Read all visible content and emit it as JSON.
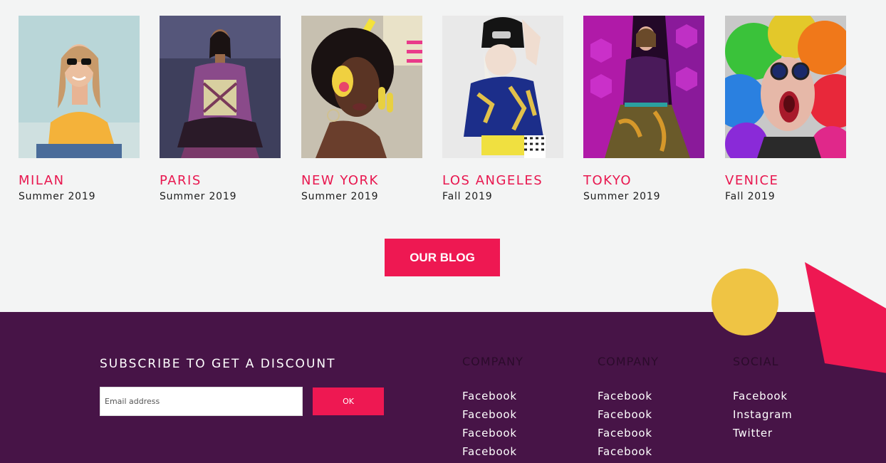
{
  "collections": [
    {
      "city": "MILAN",
      "season": "Summer 2019",
      "photo": "woman-sunglasses-yellow-shirt",
      "bg": "#b8d4d6"
    },
    {
      "city": "PARIS",
      "season": "Summer 2019",
      "photo": "model-runway-purple-top",
      "bg": "#4a4a6a"
    },
    {
      "city": "NEW YORK",
      "season": "Summer 2019",
      "photo": "woman-afro-yellow-paint",
      "bg": "#c9c4b8"
    },
    {
      "city": "LOS ANGELES",
      "season": "Fall 2019",
      "photo": "model-beanie-blue-shirt",
      "bg": "#e9e9e9"
    },
    {
      "city": "TOKYO",
      "season": "Summer 2019",
      "photo": "model-purple-hexagon-stage",
      "bg": "#7a1a8a"
    },
    {
      "city": "VENICE",
      "season": "Fall 2019",
      "photo": "person-rainbow-hair",
      "bg": "#c9c9c9"
    }
  ],
  "blog_button": "OUR BLOG",
  "subscribe": {
    "title": "SUBSCRIBE TO GET A DISCOUNT",
    "placeholder": "Email address",
    "button": "OK"
  },
  "footer_columns": [
    {
      "title": "COMPANY",
      "links": [
        "Facebook",
        "Facebook",
        "Facebook",
        "Facebook"
      ]
    },
    {
      "title": "COMPANY",
      "links": [
        "Facebook",
        "Facebook",
        "Facebook",
        "Facebook"
      ]
    },
    {
      "title": "SOCIAL",
      "links": [
        "Facebook",
        "Instagram",
        "Twitter"
      ]
    }
  ],
  "colors": {
    "accent": "#ee1852",
    "footer_bg": "#471447",
    "circle": "#efc444",
    "page_bg": "#f3f4f4"
  }
}
